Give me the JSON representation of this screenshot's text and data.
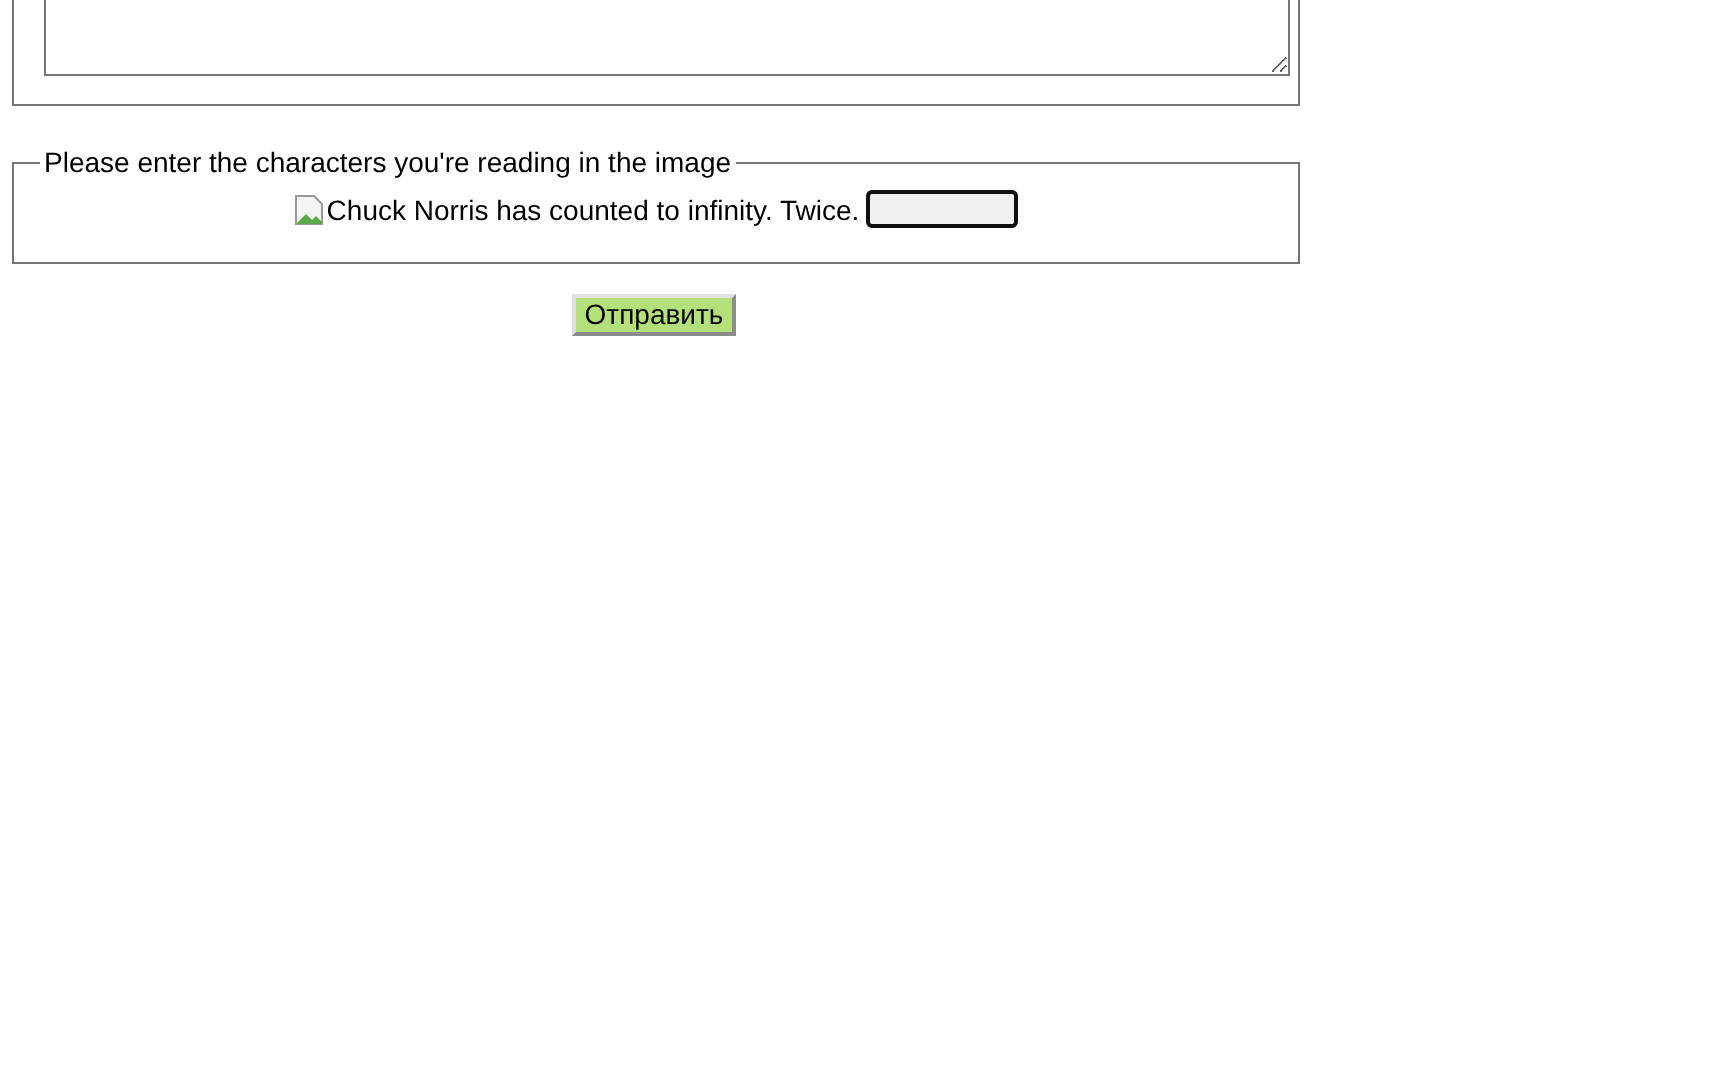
{
  "message_section": {
    "kind": "textarea"
  },
  "captcha": {
    "legend": "Please enter the characters you're reading in the image",
    "image_alt": "Chuck Norris has counted to infinity. Twice.",
    "answer_field": {
      "focused": true
    }
  },
  "submit_button": "Отправить"
}
